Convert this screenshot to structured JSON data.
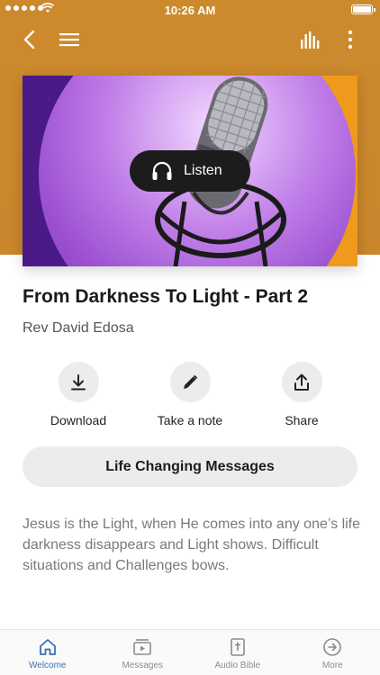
{
  "status_bar": {
    "time": "10:26 AM"
  },
  "hero": {
    "listen_label": "Listen"
  },
  "sermon": {
    "title": "From Darkness To Light - Part 2",
    "author": "Rev David Edosa",
    "description": "Jesus is the Light, when He comes into any one’s life darkness disappears and Light shows. Difficult situations and Challenges bows."
  },
  "actions": [
    {
      "label": "Download",
      "icon": "download-icon"
    },
    {
      "label": "Take a note",
      "icon": "pencil-icon"
    },
    {
      "label": "Share",
      "icon": "share-icon"
    }
  ],
  "collection_button": {
    "label": "Life Changing Messages"
  },
  "tabs": [
    {
      "label": "Welcome",
      "icon": "home-icon",
      "active": true
    },
    {
      "label": "Messages",
      "icon": "media-icon",
      "active": false
    },
    {
      "label": "Audio Bible",
      "icon": "bible-icon",
      "active": false
    },
    {
      "label": "More",
      "icon": "more-arrow-icon",
      "active": false
    }
  ],
  "colors": {
    "header": "#cd8a2d",
    "active_tab": "#3a6fb0",
    "hero_orange": "#ef9a1c",
    "hero_purple": "#4a1a86"
  }
}
